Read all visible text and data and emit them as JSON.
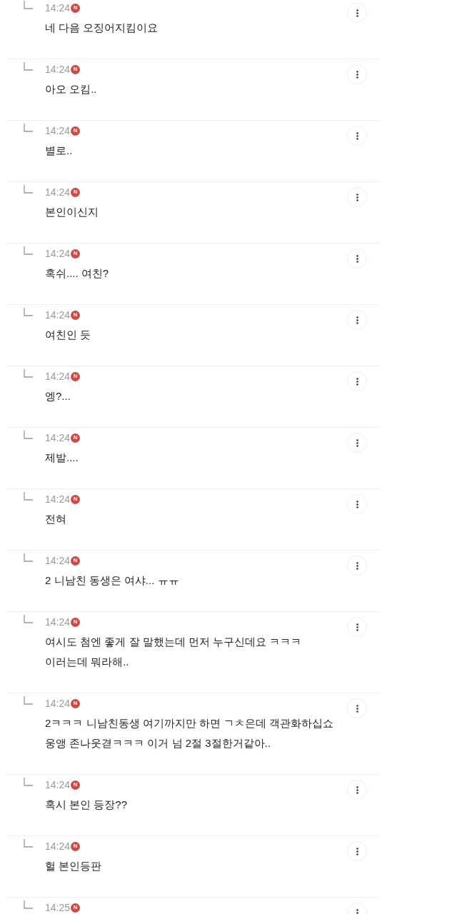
{
  "replies": [
    {
      "time": "14:24",
      "badge": "N",
      "text": "네 다음 오징어지킴이요"
    },
    {
      "time": "14:24",
      "badge": "N",
      "text": "아오 오킴.."
    },
    {
      "time": "14:24",
      "badge": "N",
      "text": "별로.."
    },
    {
      "time": "14:24",
      "badge": "N",
      "text": "본인이신지"
    },
    {
      "time": "14:24",
      "badge": "N",
      "text": "혹쉬.... 여친?"
    },
    {
      "time": "14:24",
      "badge": "N",
      "text": "여친인 듯"
    },
    {
      "time": "14:24",
      "badge": "N",
      "text": "엥?..."
    },
    {
      "time": "14:24",
      "badge": "N",
      "text": "제발...."
    },
    {
      "time": "14:24",
      "badge": "N",
      "text": "전혀"
    },
    {
      "time": "14:24",
      "badge": "N",
      "text": "2 니남친 동생은 여샤... ㅠㅠ"
    },
    {
      "time": "14:24",
      "badge": "N",
      "text": "여시도 첨엔 좋게 잘 말했는데 먼저 누구신데요 ㅋㅋㅋ\n이러는데 뭐라해.."
    },
    {
      "time": "14:24",
      "badge": "N",
      "text": "2ㅋㅋㅋ 니남친동생 여기까지만 하면 ㄱㅊ은데 객관화하십쇼\n웅앵 존나웃겯ㅋㅋㅋ 이거 넘 2절 3절한거같아.."
    },
    {
      "time": "14:24",
      "badge": "N",
      "text": "혹시 본인 등장??"
    },
    {
      "time": "14:24",
      "badge": "N",
      "text": "헐 본인등판"
    },
    {
      "time": "14:25",
      "badge": "N"
    }
  ]
}
